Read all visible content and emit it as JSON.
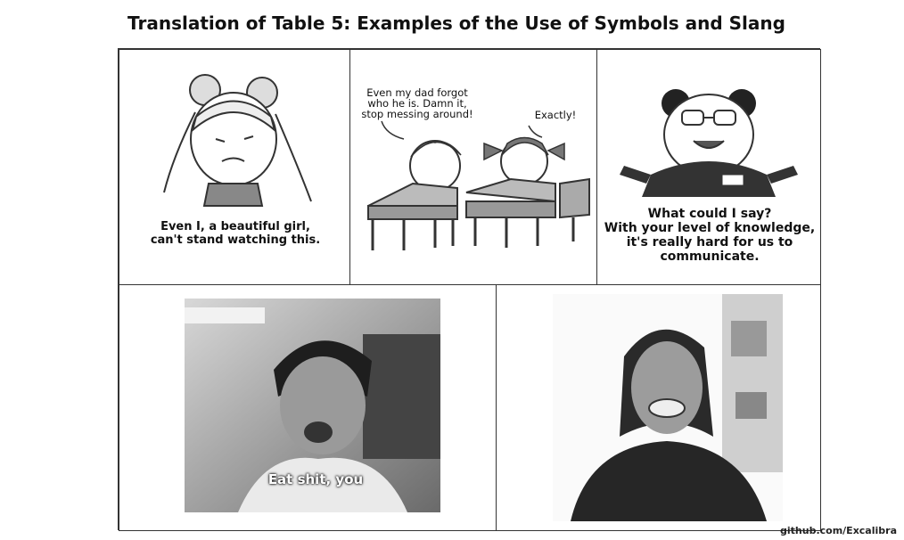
{
  "title": "Translation of Table 5: Examples of the Use of Symbols and Slang",
  "panels": {
    "p1": {
      "caption_line1": "Even I, a beautiful girl,",
      "caption_line2": "can't stand watching this."
    },
    "p2": {
      "bubble_left_1": "Even my dad forgot",
      "bubble_left_2": "who he is. Damn it,",
      "bubble_left_3": "stop messing around!",
      "bubble_right": "Exactly!"
    },
    "p3": {
      "caption_line1": "What could I say?",
      "caption_line2": "With your level of knowledge,",
      "caption_line3": "it's really hard for us to",
      "caption_line4": "communicate."
    },
    "p4": {
      "overlay": "Eat shit, you"
    },
    "p5": {}
  },
  "credit": "github.com/Excalibra"
}
